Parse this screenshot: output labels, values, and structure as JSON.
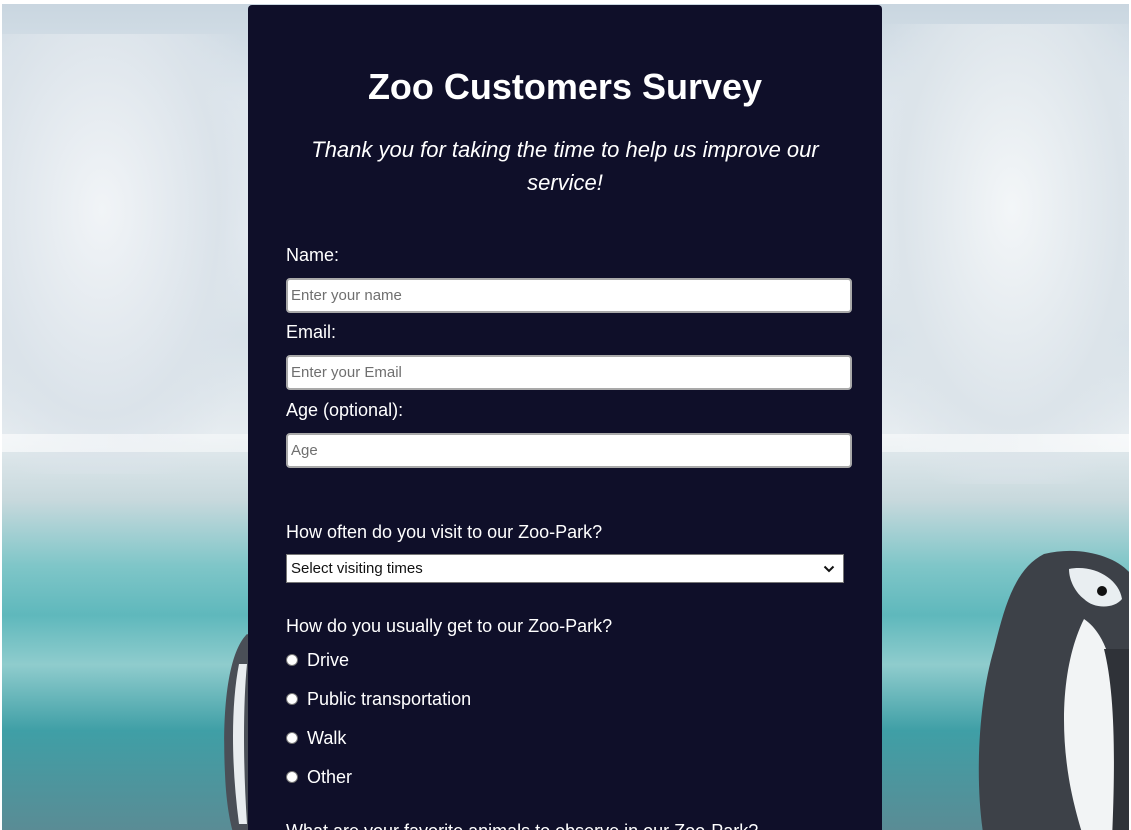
{
  "survey": {
    "title": "Zoo Customers Survey",
    "subtitle": "Thank you for taking the time to help us improve our service!",
    "name": {
      "label": "Name:",
      "placeholder": "Enter your name"
    },
    "email": {
      "label": "Email:",
      "placeholder": "Enter your Email"
    },
    "age": {
      "label": "Age (optional):",
      "placeholder": "Age"
    },
    "visit_frequency": {
      "question": "How often do you visit to our Zoo-Park?",
      "selected": "Select visiting times"
    },
    "transport": {
      "question": "How do you usually get to our Zoo-Park?",
      "options": [
        "Drive",
        "Public transportation",
        "Walk",
        "Other"
      ]
    },
    "next_question_partial": "What are your favorite animals to observe in our Zoo-Park?"
  },
  "colors": {
    "card_background": "#0f0f29",
    "text": "#ffffff"
  },
  "icons": {
    "select_arrow": "chevron-down-icon"
  }
}
